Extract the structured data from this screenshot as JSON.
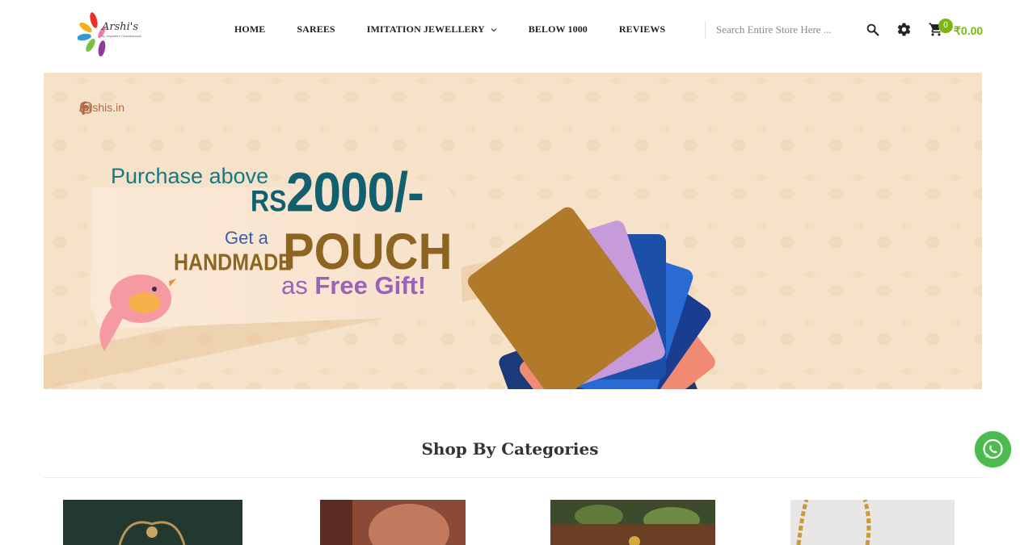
{
  "brand": {
    "name": "Arshi's",
    "tagline": "by Jeyanthi's Chandramouli"
  },
  "nav": {
    "items": [
      {
        "label": "HOME"
      },
      {
        "label": "SAREES"
      },
      {
        "label": "IMITATION JEWELLERY",
        "has_dropdown": true
      },
      {
        "label": "BELOW 1000"
      },
      {
        "label": "REVIEWS"
      }
    ]
  },
  "search": {
    "placeholder": "Search Entire Store Here ...",
    "value": ""
  },
  "cart": {
    "count": "0",
    "total": "₹0.00"
  },
  "banner": {
    "social_handle": "/arshis.in",
    "line1": "Purchase above",
    "currency": "RS.",
    "amount": "2000/-",
    "get_a": "Get a",
    "handmade": "HANDMADE",
    "pouch": "POUCH",
    "as": "as",
    "free_gift": "Free Gift!"
  },
  "section": {
    "title": "Shop By Categories"
  },
  "colors": {
    "accent_green": "#7cb518",
    "whatsapp_green": "#4cbb4f",
    "banner_bg": "#f6e2c8",
    "teal_text": "#12606d",
    "gold_text": "#8d6420",
    "purple_text": "#9a62b8"
  },
  "icons": {
    "search": "search-icon",
    "settings": "gear-icon",
    "cart": "cart-icon",
    "whatsapp": "whatsapp-icon",
    "facebook": "facebook-icon",
    "instagram": "instagram-icon"
  }
}
